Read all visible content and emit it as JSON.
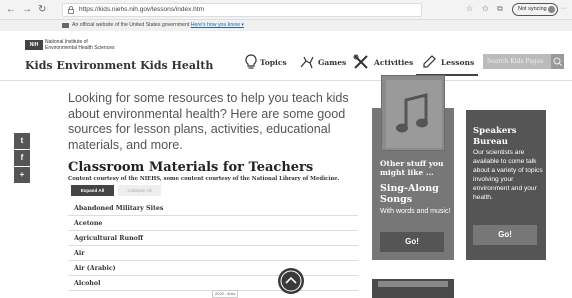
{
  "browser": {
    "url": "https://kids.niehs.nih.gov/lessons/index.htm",
    "sync_label": "Not syncing",
    "more_label": "···"
  },
  "gov_banner": {
    "text": "An official website of the United States government",
    "link": "Here's how you know ▾"
  },
  "header": {
    "logo_text": "NIH",
    "institute_line1": "National Institute of",
    "institute_line2": "Environmental Health Sciences",
    "site_title": "Kids Environment Kids Health",
    "nav": [
      "Topics",
      "Games",
      "Activities",
      "Lessons"
    ],
    "search_placeholder": "Search Kids Pages"
  },
  "social": [
    "t",
    "f",
    "+"
  ],
  "intro": "Looking for some resources to help you teach kids about environmental health? Here are some good sources for lesson plans, activities, educational materials, and more.",
  "section": {
    "title": "Classroom Materials for Teachers",
    "courtesy": "Content courtesy of the NIEHS, some content courtesy of the National Library of Medicine.",
    "expand_label": "Expand All",
    "collapse_label": "Collapse All",
    "topics": [
      "Abandoned Military Sites",
      "Acetone",
      "Agricultural Runoff",
      "Air",
      "Air (Arabic)",
      "Alcohol"
    ]
  },
  "scroll_tip": "2020 - links",
  "cards": {
    "other_stuff": "Other stuff you might like ...",
    "singalong_title": "Sing-Along Songs",
    "singalong_text": "With words and music!",
    "go1": "Go!",
    "speakers_title": "Speakers Bureau",
    "speakers_text": "Our scientists are available to come talk about a variety of topics involving your environment and your health.",
    "go2": "Go!"
  }
}
